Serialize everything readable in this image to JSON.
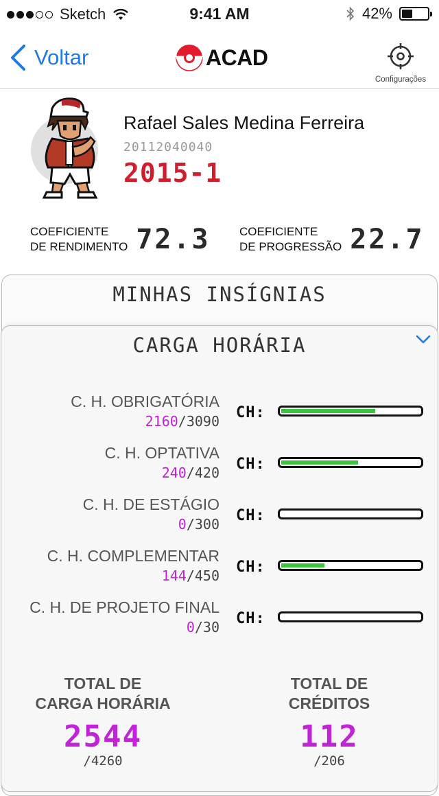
{
  "status_bar": {
    "carrier": "Sketch",
    "time": "9:41 AM",
    "battery": "42%",
    "battery_level": 0.42
  },
  "nav": {
    "back_label": "Voltar",
    "logo_text": "ACAD",
    "settings_label": "Configurações"
  },
  "profile": {
    "name": "Rafael Sales Medina Ferreira",
    "student_id": "20112040040",
    "semester": "2015-1"
  },
  "coefficients": {
    "rendimento": {
      "label_line1": "COEFICIENTE",
      "label_line2": "DE RENDIMENTO",
      "value": "72.3"
    },
    "progressao": {
      "label_line1": "COEFICIENTE",
      "label_line2": "DE PROGRESSÃO",
      "value": "22.7"
    }
  },
  "badges_panel": {
    "title": "MINHAS INSÍGNIAS"
  },
  "workload_panel": {
    "title": "CARGA HORÁRIA",
    "ch_label": "CH:",
    "rows": [
      {
        "label": "C. H. OBRIGATÓRIA",
        "done": "2160",
        "total": "/3090",
        "progress": 0.699
      },
      {
        "label": "C. H. OPTATIVA",
        "done": "240",
        "total": "/420",
        "progress": 0.571
      },
      {
        "label": "C. H. DE ESTÁGIO",
        "done": "0",
        "total": "/300",
        "progress": 0
      },
      {
        "label": "C. H. COMPLEMENTAR",
        "done": "144",
        "total": "/450",
        "progress": 0.32
      },
      {
        "label": "C. H. DE PROJETO FINAL",
        "done": "0",
        "total": "/30",
        "progress": 0
      }
    ],
    "totals": {
      "workload": {
        "label_line1": "TOTAL DE",
        "label_line2": "CARGA HORÁRIA",
        "value": "2544",
        "max": "/4260"
      },
      "credits": {
        "label_line1": "TOTAL DE",
        "label_line2": "CRÉDITOS",
        "value": "112",
        "max": "/206"
      }
    }
  },
  "colors": {
    "accent_blue": "#1f7ae8",
    "semester_red": "#d01e2e",
    "progress_green": "#3fc23f",
    "highlight_purple": "#c123d6"
  }
}
